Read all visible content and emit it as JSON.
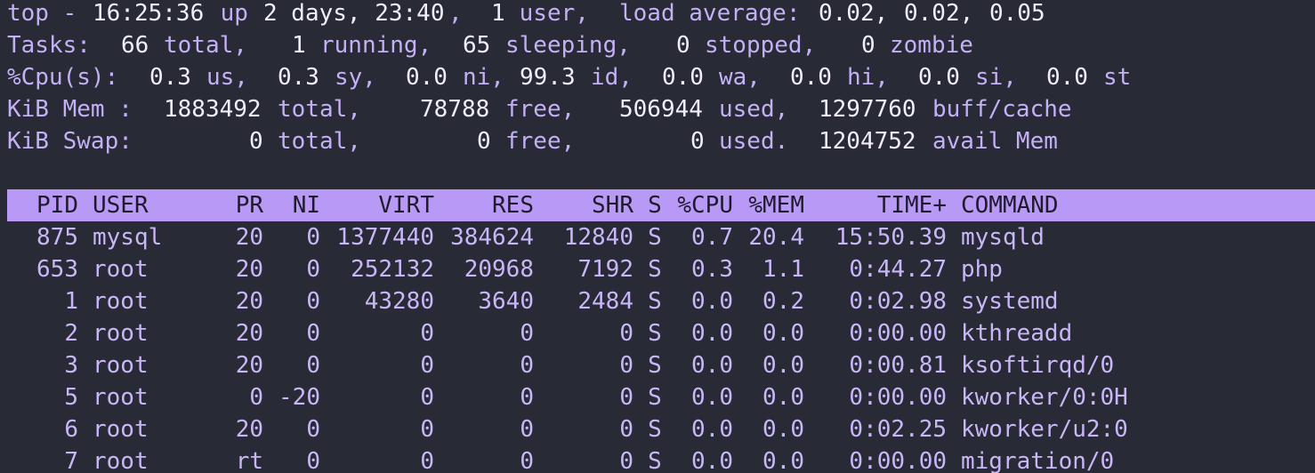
{
  "summary": {
    "l1": {
      "prefix": "top - ",
      "time": "16:25:36",
      "up_label": " up ",
      "uptime": "2 days, 23:40",
      "comma": ",",
      "users": "1",
      "users_label": " user,",
      "load_label": "load average:",
      "load1": "0.02,",
      "load5": "0.02,",
      "load15": "0.05"
    },
    "l2": {
      "label": "Tasks:",
      "total": "66",
      "total_label": "total,",
      "running": "1",
      "running_label": "running,",
      "sleeping": "65",
      "sleeping_label": "sleeping,",
      "stopped": "0",
      "stopped_label": "stopped,",
      "zombie": "0",
      "zombie_label": "zombie"
    },
    "l3": {
      "label": "%Cpu(s):",
      "us": "0.3",
      "us_label": "us,",
      "sy": "0.3",
      "sy_label": "sy,",
      "ni": "0.0",
      "ni_label": "ni,",
      "id": "99.3",
      "id_label": "id,",
      "wa": "0.0",
      "wa_label": "wa,",
      "hi": "0.0",
      "hi_label": "hi,",
      "si": "0.0",
      "si_label": "si,",
      "st": "0.0",
      "st_label": "st"
    },
    "l4": {
      "label": "KiB Mem :",
      "total": "1883492",
      "total_label": "total,",
      "free": "78788",
      "free_label": "free,",
      "used": "506944",
      "used_label": "used,",
      "buff": "1297760",
      "buff_label": "buff/cache"
    },
    "l5": {
      "label": "KiB Swap:",
      "total": "0",
      "total_label": "total,",
      "free": "0",
      "free_label": "free,",
      "used": "0",
      "used_label": "used.",
      "avail": "1204752",
      "avail_label": "avail Mem"
    }
  },
  "columns": [
    "PID",
    "USER",
    "PR",
    "NI",
    "VIRT",
    "RES",
    "SHR",
    "S",
    "%CPU",
    "%MEM",
    "TIME+",
    "COMMAND"
  ],
  "processes": [
    [
      "875",
      "mysql",
      "20",
      "0",
      "1377440",
      "384624",
      "12840",
      "S",
      "0.7",
      "20.4",
      "15:50.39",
      "mysqld"
    ],
    [
      "653",
      "root",
      "20",
      "0",
      "252132",
      "20968",
      "7192",
      "S",
      "0.3",
      "1.1",
      "0:44.27",
      "php"
    ],
    [
      "1",
      "root",
      "20",
      "0",
      "43280",
      "3640",
      "2484",
      "S",
      "0.0",
      "0.2",
      "0:02.98",
      "systemd"
    ],
    [
      "2",
      "root",
      "20",
      "0",
      "0",
      "0",
      "0",
      "S",
      "0.0",
      "0.0",
      "0:00.00",
      "kthreadd"
    ],
    [
      "3",
      "root",
      "20",
      "0",
      "0",
      "0",
      "0",
      "S",
      "0.0",
      "0.0",
      "0:00.81",
      "ksoftirqd/0"
    ],
    [
      "5",
      "root",
      "0",
      "-20",
      "0",
      "0",
      "0",
      "S",
      "0.0",
      "0.0",
      "0:00.00",
      "kworker/0:0H"
    ],
    [
      "6",
      "root",
      "20",
      "0",
      "0",
      "0",
      "0",
      "S",
      "0.0",
      "0.0",
      "0:02.25",
      "kworker/u2:0"
    ],
    [
      "7",
      "root",
      "rt",
      "0",
      "0",
      "0",
      "0",
      "S",
      "0.0",
      "0.0",
      "0:00.00",
      "migration/0"
    ]
  ],
  "colors": {
    "background": "#282a36",
    "text": "#c9b6f7",
    "highlight": "#f0ecf8",
    "header_bar": "#b89af6",
    "header_text": "#1f1b2d"
  }
}
